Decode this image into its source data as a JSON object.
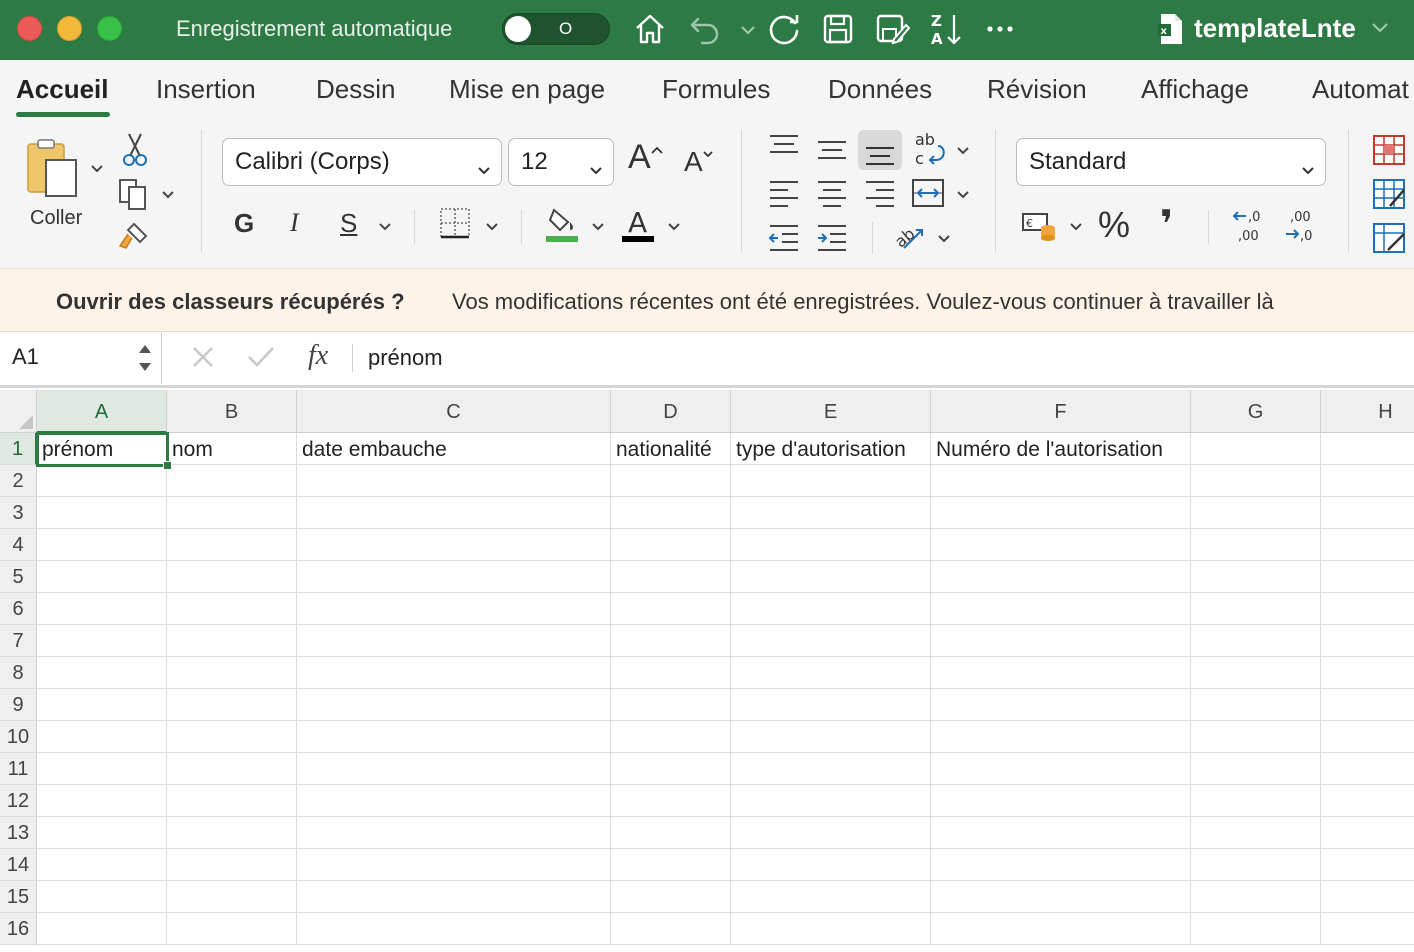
{
  "titlebar": {
    "autosave_label": "Enregistrement automatique",
    "autosave_state": "O",
    "doc_title": "templateLnte"
  },
  "tabs": [
    {
      "label": "Accueil",
      "active": true
    },
    {
      "label": "Insertion"
    },
    {
      "label": "Dessin"
    },
    {
      "label": "Mise en page"
    },
    {
      "label": "Formules"
    },
    {
      "label": "Données"
    },
    {
      "label": "Révision"
    },
    {
      "label": "Affichage"
    },
    {
      "label": "Automat"
    }
  ],
  "ribbon": {
    "paste_label": "Coller",
    "font_name": "Calibri (Corps)",
    "font_size": "12",
    "bold_label": "G",
    "italic_label": "I",
    "underline_label": "S",
    "grow_font": "A",
    "shrink_font": "A",
    "number_format": "Standard",
    "percent": "%",
    "comma": "❜",
    "fill_color": "#4caf50",
    "font_color": "#000000"
  },
  "notification": {
    "title": "Ouvrir des classeurs récupérés ?",
    "message": "Vos modifications récentes ont été enregistrées. Voulez-vous continuer à travailler là"
  },
  "formula_bar": {
    "name_box": "A1",
    "fx": "fx",
    "content": "prénom"
  },
  "grid": {
    "columns": [
      "A",
      "B",
      "C",
      "D",
      "E",
      "F",
      "G",
      "H"
    ],
    "rows": [
      "1",
      "2",
      "3",
      "4",
      "5",
      "6",
      "7",
      "8",
      "9",
      "10",
      "11",
      "12",
      "13",
      "14",
      "15",
      "16"
    ],
    "row1": [
      "prénom",
      "nom",
      "date embauche",
      "nationalité",
      "type d'autorisation",
      "Numéro de l'autorisation",
      "",
      ""
    ],
    "selected_cell": "A1"
  }
}
